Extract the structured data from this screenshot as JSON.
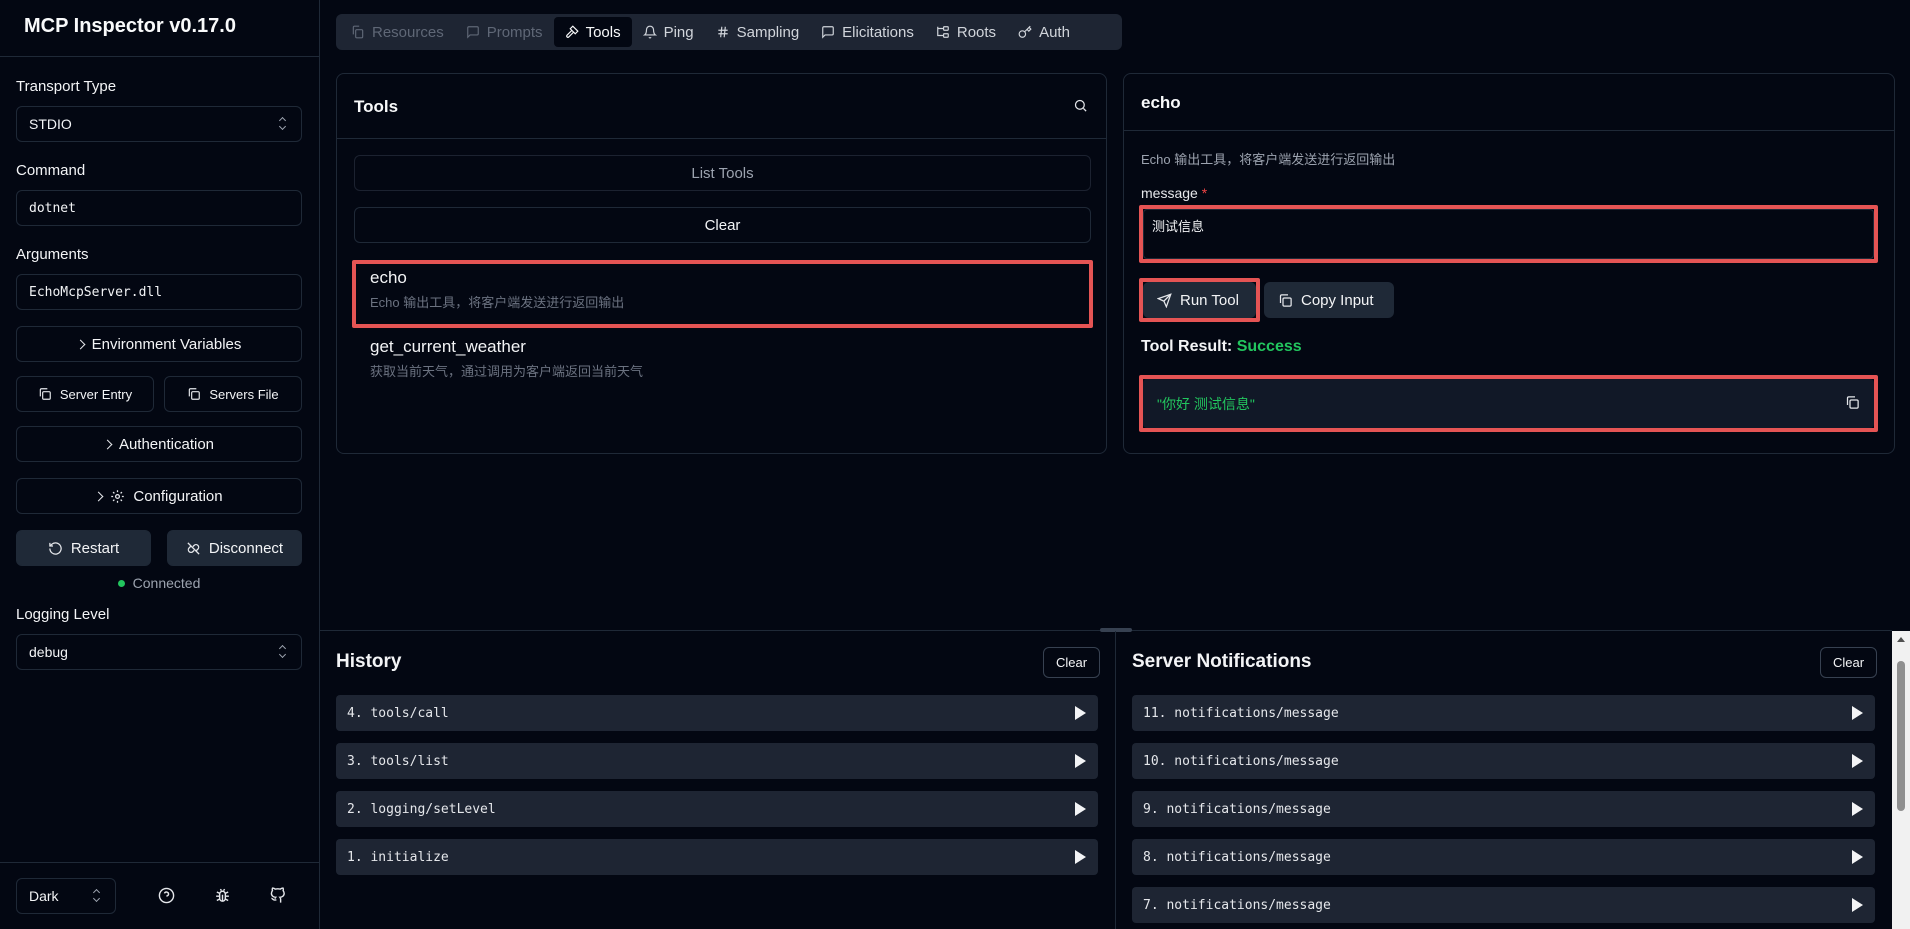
{
  "app": {
    "title": "MCP Inspector v0.17.0"
  },
  "sidebar": {
    "transport_label": "Transport Type",
    "transport_value": "STDIO",
    "command_label": "Command",
    "command_value": "dotnet",
    "arguments_label": "Arguments",
    "arguments_value": "EchoMcpServer.dll",
    "env_vars_label": "Environment Variables",
    "server_entry_label": "Server Entry",
    "servers_file_label": "Servers File",
    "authentication_label": "Authentication",
    "configuration_label": "Configuration",
    "restart_label": "Restart",
    "disconnect_label": "Disconnect",
    "status_text": "Connected",
    "status_color": "#22c55e",
    "logging_label": "Logging Level",
    "logging_value": "debug",
    "theme_value": "Dark",
    "footer_icons": [
      "help-icon",
      "bug-icon",
      "github-icon"
    ]
  },
  "tabs": [
    {
      "label": "Resources",
      "icon": "files-icon",
      "state": "disabled"
    },
    {
      "label": "Prompts",
      "icon": "message-icon",
      "state": "disabled"
    },
    {
      "label": "Tools",
      "icon": "hammer-icon",
      "state": "active"
    },
    {
      "label": "Ping",
      "icon": "bell-icon",
      "state": "normal"
    },
    {
      "label": "Sampling",
      "icon": "hash-icon",
      "state": "normal"
    },
    {
      "label": "Elicitations",
      "icon": "message-square-icon",
      "state": "normal"
    },
    {
      "label": "Roots",
      "icon": "folder-tree-icon",
      "state": "normal"
    },
    {
      "label": "Auth",
      "icon": "key-icon",
      "state": "normal"
    }
  ],
  "tools_panel": {
    "title": "Tools",
    "list_tools_label": "List Tools",
    "clear_label": "Clear",
    "items": [
      {
        "name": "echo",
        "description": "Echo 输出工具，将客户端发送进行返回输出"
      },
      {
        "name": "get_current_weather",
        "description": "获取当前天气，通过调用为客户端返回当前天气"
      }
    ]
  },
  "tool_detail": {
    "title": "echo",
    "description": "Echo 输出工具，将客户端发送进行返回输出",
    "param_label": "message",
    "required_mark": "*",
    "param_value": "测试信息",
    "run_label": "Run Tool",
    "copy_input_label": "Copy Input",
    "result_label": "Tool Result:",
    "result_status": "Success",
    "result_value": "\"你好  测试信息\"",
    "accent_success": "#22c55e",
    "highlight_color": "#e55454"
  },
  "history": {
    "title": "History",
    "clear_label": "Clear",
    "items": [
      "4. tools/call",
      "3. tools/list",
      "2. logging/setLevel",
      "1. initialize"
    ]
  },
  "notifications": {
    "title": "Server Notifications",
    "clear_label": "Clear",
    "items": [
      "11. notifications/message",
      "10. notifications/message",
      "9. notifications/message",
      "8. notifications/message",
      "7. notifications/message"
    ]
  }
}
